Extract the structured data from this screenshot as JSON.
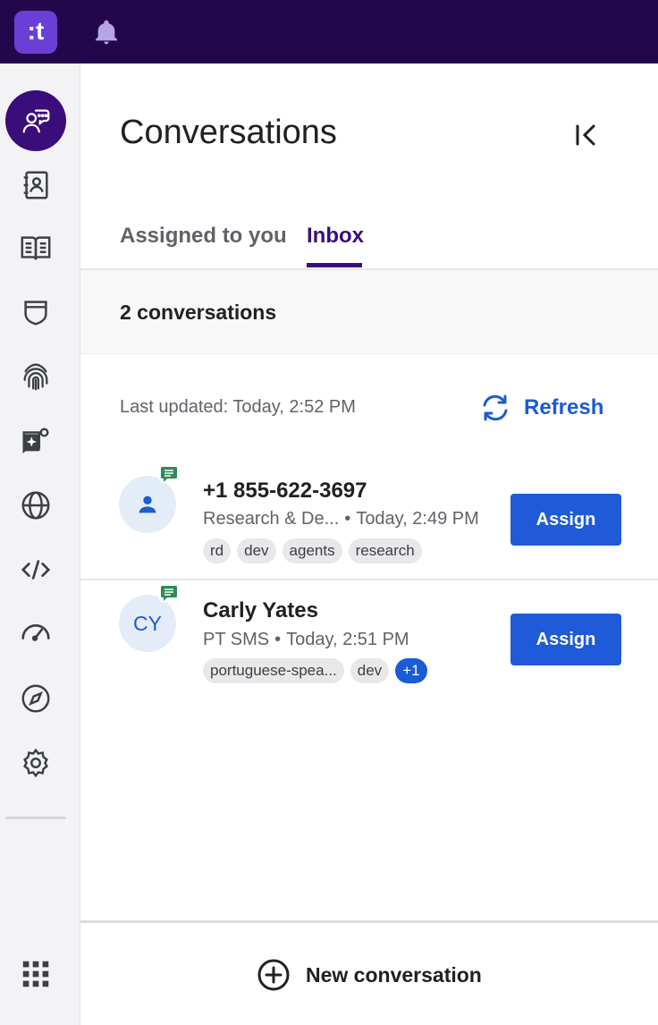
{
  "topbar": {
    "logo_text": ":t",
    "logo_icon": "app-logo",
    "bell_icon": "bell-icon"
  },
  "sidebar": {
    "items": [
      {
        "name": "conversations",
        "icon": "chat-person-icon",
        "active": true
      },
      {
        "name": "contacts",
        "icon": "contact-book-icon"
      },
      {
        "name": "knowledge",
        "icon": "open-book-icon"
      },
      {
        "name": "security",
        "icon": "shield-icon"
      },
      {
        "name": "identity",
        "icon": "fingerprint-icon"
      },
      {
        "name": "ai-settings",
        "icon": "sparkle-gear-icon"
      },
      {
        "name": "web",
        "icon": "globe-icon"
      },
      {
        "name": "developer",
        "icon": "code-icon"
      },
      {
        "name": "performance",
        "icon": "speedometer-icon"
      },
      {
        "name": "explore",
        "icon": "compass-icon"
      },
      {
        "name": "settings",
        "icon": "gear-icon"
      },
      {
        "name": "apps",
        "icon": "grid-icon"
      }
    ]
  },
  "main": {
    "title": "Conversations",
    "tabs": [
      {
        "label": "Assigned to you"
      },
      {
        "label": "Inbox",
        "active": true
      }
    ],
    "count_text": "2 conversations",
    "last_updated": "Last updated: Today, 2:52 PM",
    "refresh_label": "Refresh",
    "conversations": [
      {
        "avatar_text": "",
        "avatar_icon": "person-icon",
        "channel_icon": "message-icon",
        "name": "+1 855-622-3697",
        "source": "Research & De...",
        "separator": "•",
        "time": "Today, 2:49 PM",
        "tags": [
          "rd",
          "dev",
          "agents",
          "research"
        ],
        "assign_label": "Assign"
      },
      {
        "avatar_text": "CY",
        "channel_icon": "message-icon",
        "name": "Carly Yates",
        "source": "PT SMS",
        "separator": "•",
        "time": "Today, 2:51 PM",
        "tags": [
          "portuguese-spea...",
          "dev"
        ],
        "more_tags": "+1",
        "assign_label": "Assign"
      }
    ],
    "new_conversation_label": "New conversation"
  },
  "colors": {
    "topbar": "#23074d",
    "accent_purple": "#3b0d7a",
    "accent_blue": "#1f5bd8",
    "tag_bg": "#e8e8ea"
  }
}
